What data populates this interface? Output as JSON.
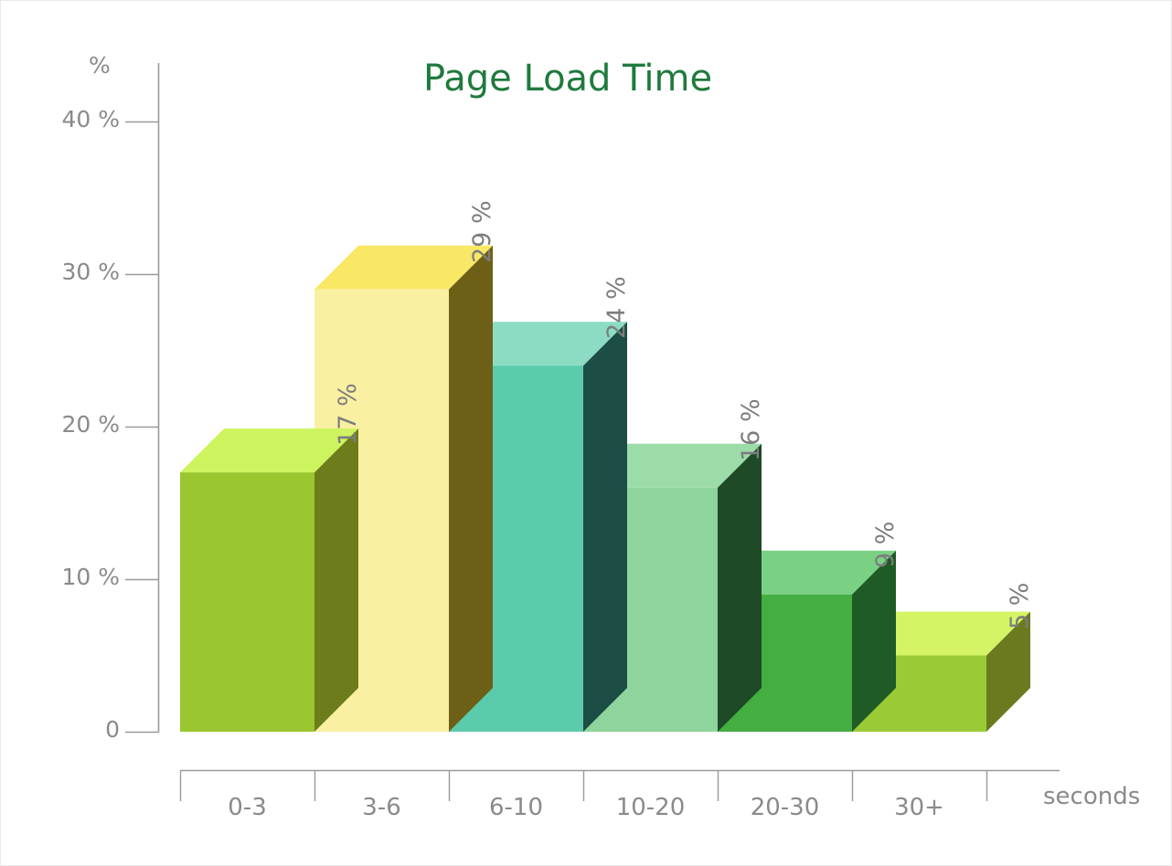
{
  "chart": {
    "title": "Page Load Time",
    "title_color": "#1f7a3d",
    "axis_color": "#9a9a9a",
    "label_color": "#8a8a8a",
    "value_label_color": "#7d7d7d",
    "background": "#ffffff"
  },
  "y_axis": {
    "unit": "%",
    "ticks": [
      {
        "label": "40 %",
        "value": 40
      },
      {
        "label": "30 %",
        "value": 30
      },
      {
        "label": "20 %",
        "value": 20
      },
      {
        "label": "10 %",
        "value": 10
      },
      {
        "label": "0",
        "value": 0
      }
    ]
  },
  "x_axis": {
    "unit": "seconds"
  },
  "chart_data": {
    "type": "bar",
    "title": "Page Load Time",
    "xlabel": "seconds",
    "ylabel": "%",
    "ylim": [
      0,
      42
    ],
    "grid": false,
    "legend": "none",
    "style": "3d-bar",
    "categories": [
      "0-3",
      "3-6",
      "6-10",
      "10-20",
      "20-30",
      "30+"
    ],
    "values": [
      17,
      29,
      24,
      16,
      9,
      5
    ],
    "value_labels": [
      "17 %",
      "29 %",
      "24 %",
      "16 %",
      "9 %",
      "5 %"
    ],
    "bar_colors": [
      {
        "front": "#9ac72f",
        "top": "#cdf45f",
        "side": "#6d7d1c"
      },
      {
        "front": "#faf0a2",
        "top": "#f8e865",
        "side": "#6d5f16"
      },
      {
        "front": "#5ccbab",
        "top": "#8cdcc3",
        "side": "#1d4e45"
      },
      {
        "front": "#8ed49c",
        "top": "#9cdca9",
        "side": "#1e4a27"
      },
      {
        "front": "#44ae43",
        "top": "#7ad184",
        "side": "#1f5b25"
      },
      {
        "front": "#9acb37",
        "top": "#d4f466",
        "side": "#6b7a1e"
      }
    ]
  }
}
